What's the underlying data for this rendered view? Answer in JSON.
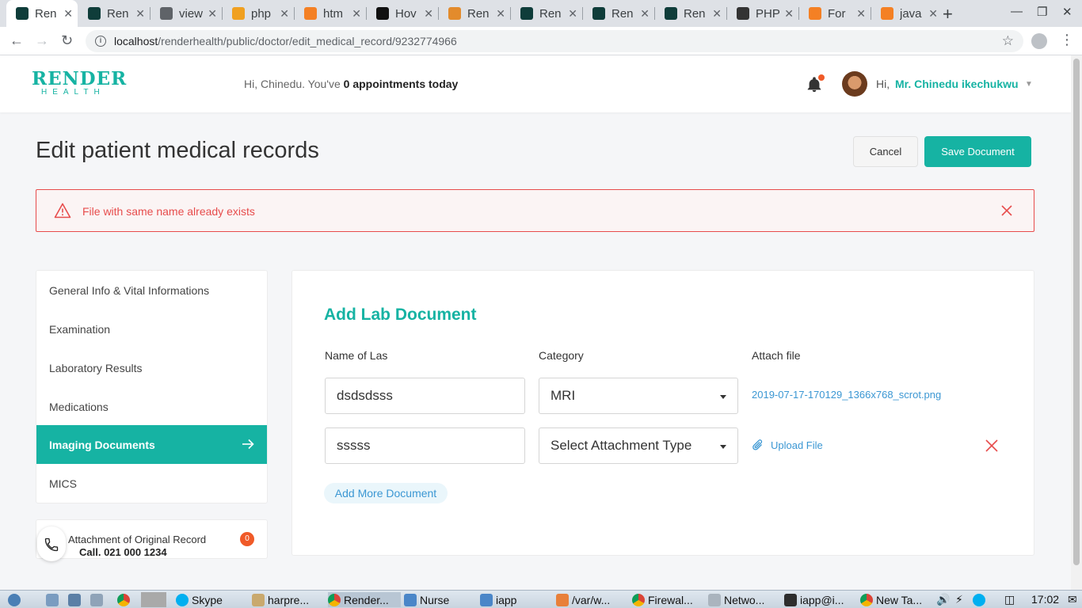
{
  "browser": {
    "tabs": [
      {
        "title": "Ren",
        "active": true,
        "color": "#0f3d3a"
      },
      {
        "title": "Ren",
        "active": false,
        "color": "#0f3d3a"
      },
      {
        "title": "view",
        "active": false,
        "color": "#5f6368"
      },
      {
        "title": "php",
        "active": false,
        "color": "#f0a020"
      },
      {
        "title": "htm",
        "active": false,
        "color": "#f48024"
      },
      {
        "title": "Hov",
        "active": false,
        "color": "#111111"
      },
      {
        "title": "Ren",
        "active": false,
        "color": "#e38b2c"
      },
      {
        "title": "Ren",
        "active": false,
        "color": "#0f3d3a"
      },
      {
        "title": "Ren",
        "active": false,
        "color": "#0f3d3a"
      },
      {
        "title": "Ren",
        "active": false,
        "color": "#0f3d3a"
      },
      {
        "title": "PHP",
        "active": false,
        "color": "#333333"
      },
      {
        "title": "For",
        "active": false,
        "color": "#f48024"
      },
      {
        "title": "java",
        "active": false,
        "color": "#f48024"
      }
    ],
    "url_host": "localhost",
    "url_path": "/renderhealth/public/doctor/edit_medical_record/9232774966"
  },
  "header": {
    "logo_line1": "RENDER",
    "logo_line2": "HEALTH",
    "greeting_prefix": "Hi, Chinedu. You've",
    "greeting_count": "0 appointments today",
    "hi": "Hi,",
    "user_name": "Mr. Chinedu ikechukwu"
  },
  "page": {
    "title": "Edit patient medical records",
    "cancel_label": "Cancel",
    "save_label": "Save Document"
  },
  "alert": {
    "message": "File with same name already exists"
  },
  "sidebar": {
    "items": [
      {
        "label": "General Info & Vital Informations",
        "active": false
      },
      {
        "label": "Examination",
        "active": false
      },
      {
        "label": "Laboratory Results",
        "active": false
      },
      {
        "label": "Medications",
        "active": false
      },
      {
        "label": "Imaging Documents",
        "active": true
      },
      {
        "label": "MICS",
        "active": false
      }
    ],
    "attachment_label": "Attachment of Original Record",
    "attachment_count": "0",
    "call_text": "Call. 021 000 1234"
  },
  "form": {
    "title": "Add Lab Document",
    "col_name": "Name of Las",
    "col_category": "Category",
    "col_attach": "Attach file",
    "rows": [
      {
        "name": "dsdsdsss",
        "category": "MRI",
        "file": "2019-07-17-170129_1366x768_scrot.png"
      },
      {
        "name": "sssss",
        "category": "Select Attachment Type",
        "upload_label": "Upload File"
      }
    ],
    "add_more_label": "Add More Document"
  },
  "taskbar": {
    "items": [
      "Skype",
      "harpre...",
      "Render...",
      "Nurse",
      "iapp",
      "/var/w...",
      "Firewal...",
      "Netwo...",
      "iapp@i...",
      "New Ta..."
    ],
    "time": "17:02"
  },
  "colors": {
    "accent": "#16b3a3",
    "error": "#e74c4c",
    "link": "#3b97d3",
    "badge": "#f05a28"
  }
}
